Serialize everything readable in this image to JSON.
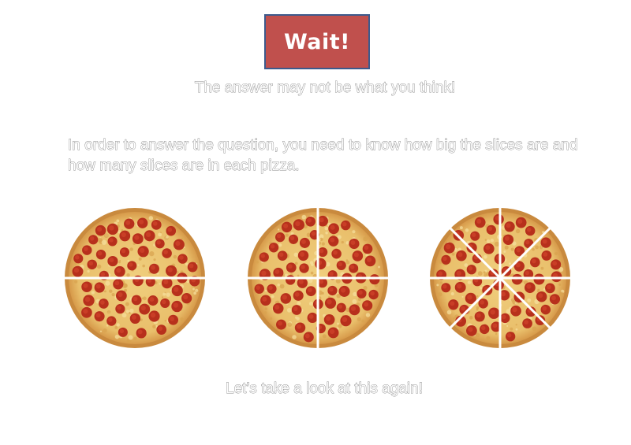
{
  "slide": {
    "title": "Wait!",
    "subtitle": "The answer may not be what you think!",
    "paragraph": "In order to answer the question, you need to know how big the slices are and how many slices are in each pizza.",
    "footer": "Let’s take a look at this again!"
  },
  "pizzas": [
    {
      "slices": 2
    },
    {
      "slices": 4
    },
    {
      "slices": 8
    }
  ],
  "colors": {
    "title_fill": "#c0504d",
    "title_border": "#3c5a8c",
    "crust": "#c98a3e",
    "cheese": "#e9bf6b",
    "pepperoni": "#b7301c",
    "slice_cut": "#ffffff"
  }
}
